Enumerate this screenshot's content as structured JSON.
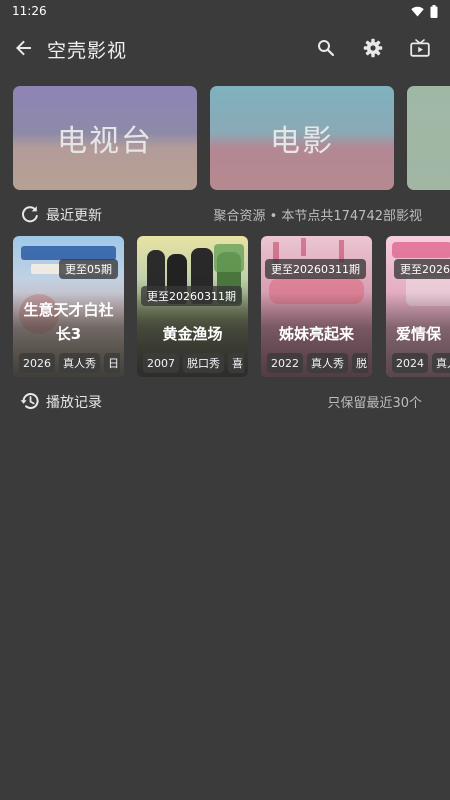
{
  "status_bar": {
    "time": "11:26"
  },
  "app_bar": {
    "title": "空壳影视"
  },
  "categories": [
    {
      "label": "电视台"
    },
    {
      "label": "电影"
    },
    {
      "label": ""
    }
  ],
  "recent": {
    "title": "最近更新",
    "meta": "聚合资源 • 本节点共174742部影视",
    "items": [
      {
        "update": "更至05期",
        "title": "生意天才白社长3",
        "tags": [
          "2026",
          "真人秀",
          "日"
        ]
      },
      {
        "update": "更至20260311期",
        "title": "黄金渔场",
        "tags": [
          "2007",
          "脱口秀",
          "喜"
        ]
      },
      {
        "update": "更至20260311期",
        "title": "姊妹亮起来",
        "tags": [
          "2022",
          "真人秀",
          "脱"
        ]
      },
      {
        "update": "更至2026",
        "title": "爱情保",
        "tags": [
          "2024",
          "真人"
        ]
      }
    ]
  },
  "history": {
    "title": "播放记录",
    "meta": "只保留最近30个"
  }
}
